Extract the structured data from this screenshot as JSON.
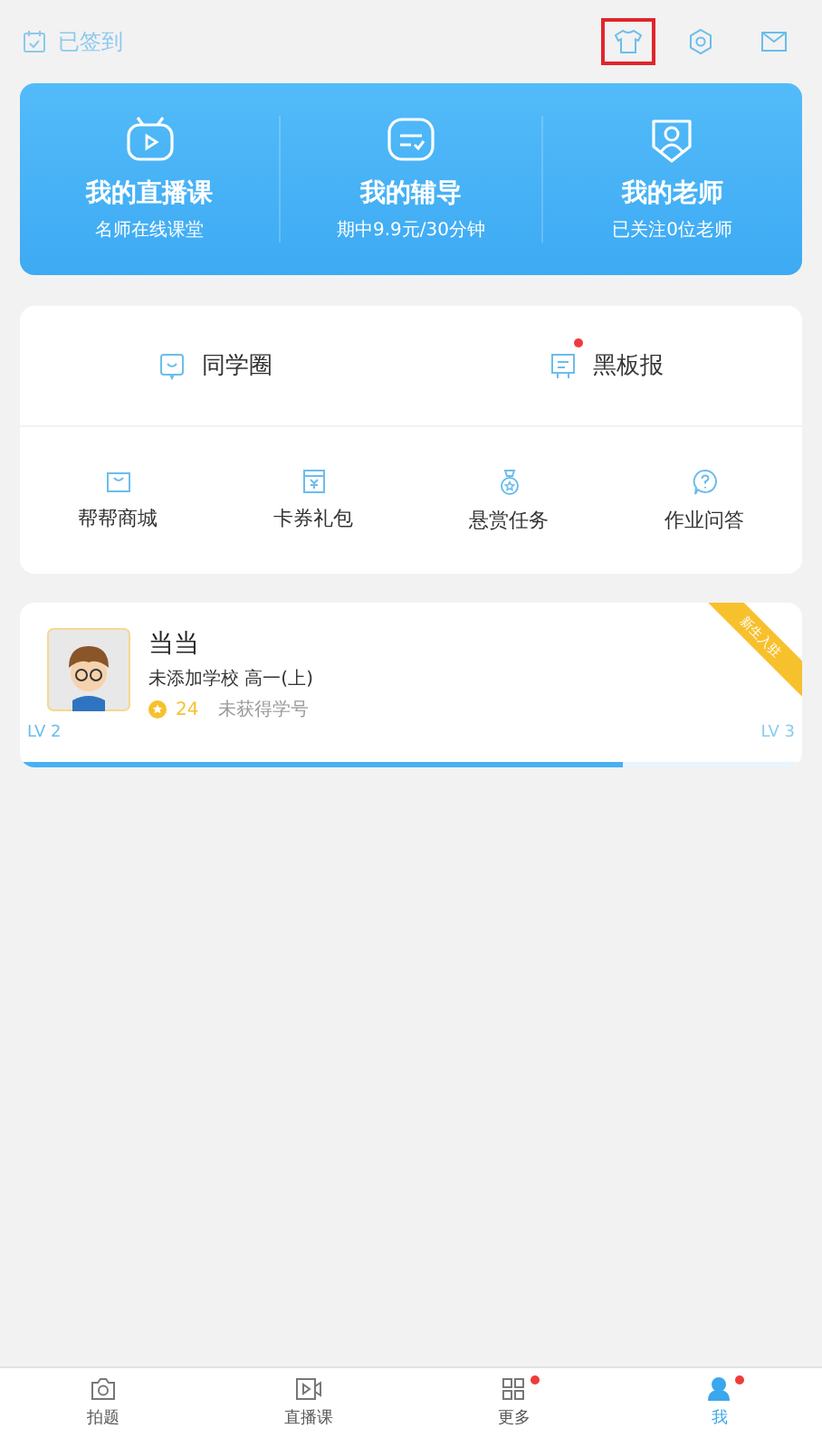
{
  "top_bar": {
    "checkin": "已签到",
    "actions": [
      {
        "kind": "shirt",
        "highlighted": true
      },
      {
        "kind": "gear",
        "highlighted": false
      },
      {
        "kind": "mail",
        "highlighted": false
      }
    ]
  },
  "blue_card": [
    {
      "kind": "live",
      "title": "我的直播课",
      "subtitle": "名师在线课堂"
    },
    {
      "kind": "tutor",
      "title": "我的辅导",
      "subtitle": "期中9.9元/30分钟"
    },
    {
      "kind": "teacher",
      "title": "我的老师",
      "subtitle": "已关注0位老师"
    }
  ],
  "feature_row": [
    {
      "kind": "circle",
      "label": "同学圈",
      "badge": false
    },
    {
      "kind": "board",
      "label": "黑板报",
      "badge": true
    }
  ],
  "services": [
    {
      "kind": "bag",
      "label": "帮帮商城"
    },
    {
      "kind": "coupon",
      "label": "卡券礼包"
    },
    {
      "kind": "bounty",
      "label": "悬赏任务"
    },
    {
      "kind": "question",
      "label": "作业问答"
    }
  ],
  "profile": {
    "name": "当当",
    "school": "未添加学校 高一(上)",
    "points": "24",
    "student_id": "未获得学号",
    "ribbon": "新生入驻",
    "level_from": "LV 2",
    "level_to": "LV 3",
    "level": 0.77
  },
  "tabs": [
    {
      "kind": "camera",
      "label": "拍题",
      "selected": false,
      "badge": false
    },
    {
      "kind": "video",
      "label": "直播课",
      "selected": false,
      "badge": false
    },
    {
      "kind": "more",
      "label": "更多",
      "selected": false,
      "badge": true
    },
    {
      "kind": "me",
      "label": "我",
      "selected": true,
      "badge": true
    }
  ]
}
